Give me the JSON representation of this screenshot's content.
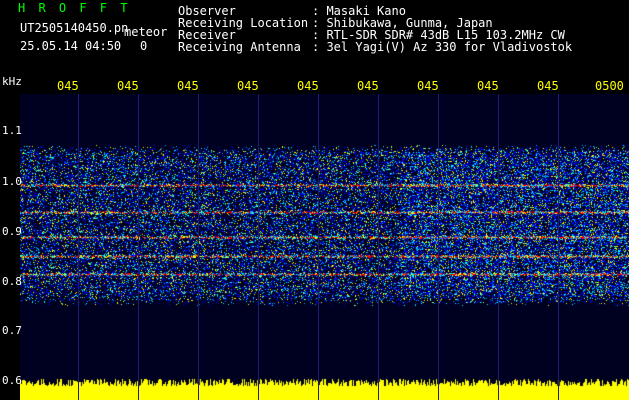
{
  "station": {
    "name": "H R O F F T",
    "file": "UT2505140450.pn",
    "file_suffix": "meteor",
    "datetime": "25.05.14 04:50",
    "index": "0"
  },
  "info": {
    "observer_label": "Observer",
    "observer_value": ": Masaki Kano",
    "location_label": "Receiving Location",
    "location_value": ": Shibukawa, Gunma, Japan",
    "receiver_label": "Receiver",
    "receiver_value": ": RTL-SDR SDR# 43dB L15 103.2MHz CW",
    "antenna_label": "Receiving Antenna",
    "antenna_value": ": 3el Yagi(V) Az 330 for Vladivostok"
  },
  "axis": {
    "unit": "kHz",
    "time_ticks": [
      "045",
      "045",
      "045",
      "045",
      "045",
      "045",
      "045",
      "045",
      "045",
      "0500"
    ],
    "freq_ticks": [
      "1.1",
      "1.0",
      "0.9",
      "0.8",
      "0.7",
      "0.6"
    ]
  },
  "colors": {
    "background": "#000000",
    "plot_bg": "#000020",
    "signal_low": "#0000ff",
    "signal_mid": "#00ffff",
    "signal_high": "#ff0000",
    "baseline": "#ffff00",
    "tick_text": "#ffff00",
    "station_text": "#00ff00"
  }
}
